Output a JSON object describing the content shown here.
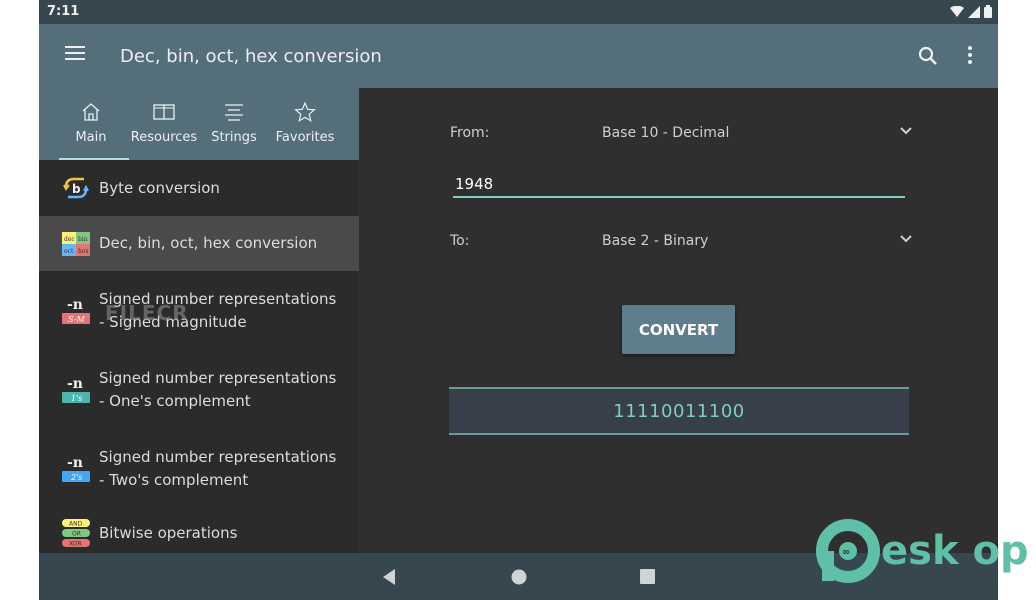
{
  "status_bar": {
    "time": "7:11"
  },
  "app_bar": {
    "title": "Dec, bin, oct, hex conversion"
  },
  "tabs": [
    {
      "label": "Main",
      "icon": "home-icon",
      "active": true
    },
    {
      "label": "Resources",
      "icon": "book-icon",
      "active": false
    },
    {
      "label": "Strings",
      "icon": "text-align-icon",
      "active": false
    },
    {
      "label": "Favorites",
      "icon": "star-icon",
      "active": false
    }
  ],
  "list": [
    {
      "line1": "Byte conversion",
      "line2": ""
    },
    {
      "line1": "Dec, bin, oct, hex conversion",
      "line2": "",
      "selected": true,
      "icon_labels": [
        "dec",
        "bin",
        "oct",
        "hex"
      ]
    },
    {
      "line1": "Signed number representations",
      "line2": "- Signed magnitude",
      "badge": "S-M",
      "badge_color": "#e57373",
      "prefix": "-n"
    },
    {
      "line1": "Signed number representations",
      "line2": "- One's complement",
      "badge": "1's",
      "badge_color": "#4db6ac",
      "prefix": "-n"
    },
    {
      "line1": "Signed number representations",
      "line2": "- Two's complement",
      "badge": "2's",
      "badge_color": "#42a5f5",
      "prefix": "-n"
    },
    {
      "line1": "Bitwise operations",
      "line2": "",
      "icon_labels": [
        "AND",
        "OR",
        "XOR"
      ]
    }
  ],
  "converter": {
    "from_label": "From:",
    "from_value": "Base 10 - Decimal",
    "input_value": "1948",
    "to_label": "To:",
    "to_value": "Base 2 - Binary",
    "convert_label": "CONVERT",
    "result": "11110011100"
  },
  "watermarks": {
    "filecr": "FILECR",
    "desktop": "esk op"
  },
  "colors": {
    "app_bar": "#546e7a",
    "accent": "#80cbc4",
    "background": "#2f2f2f"
  }
}
